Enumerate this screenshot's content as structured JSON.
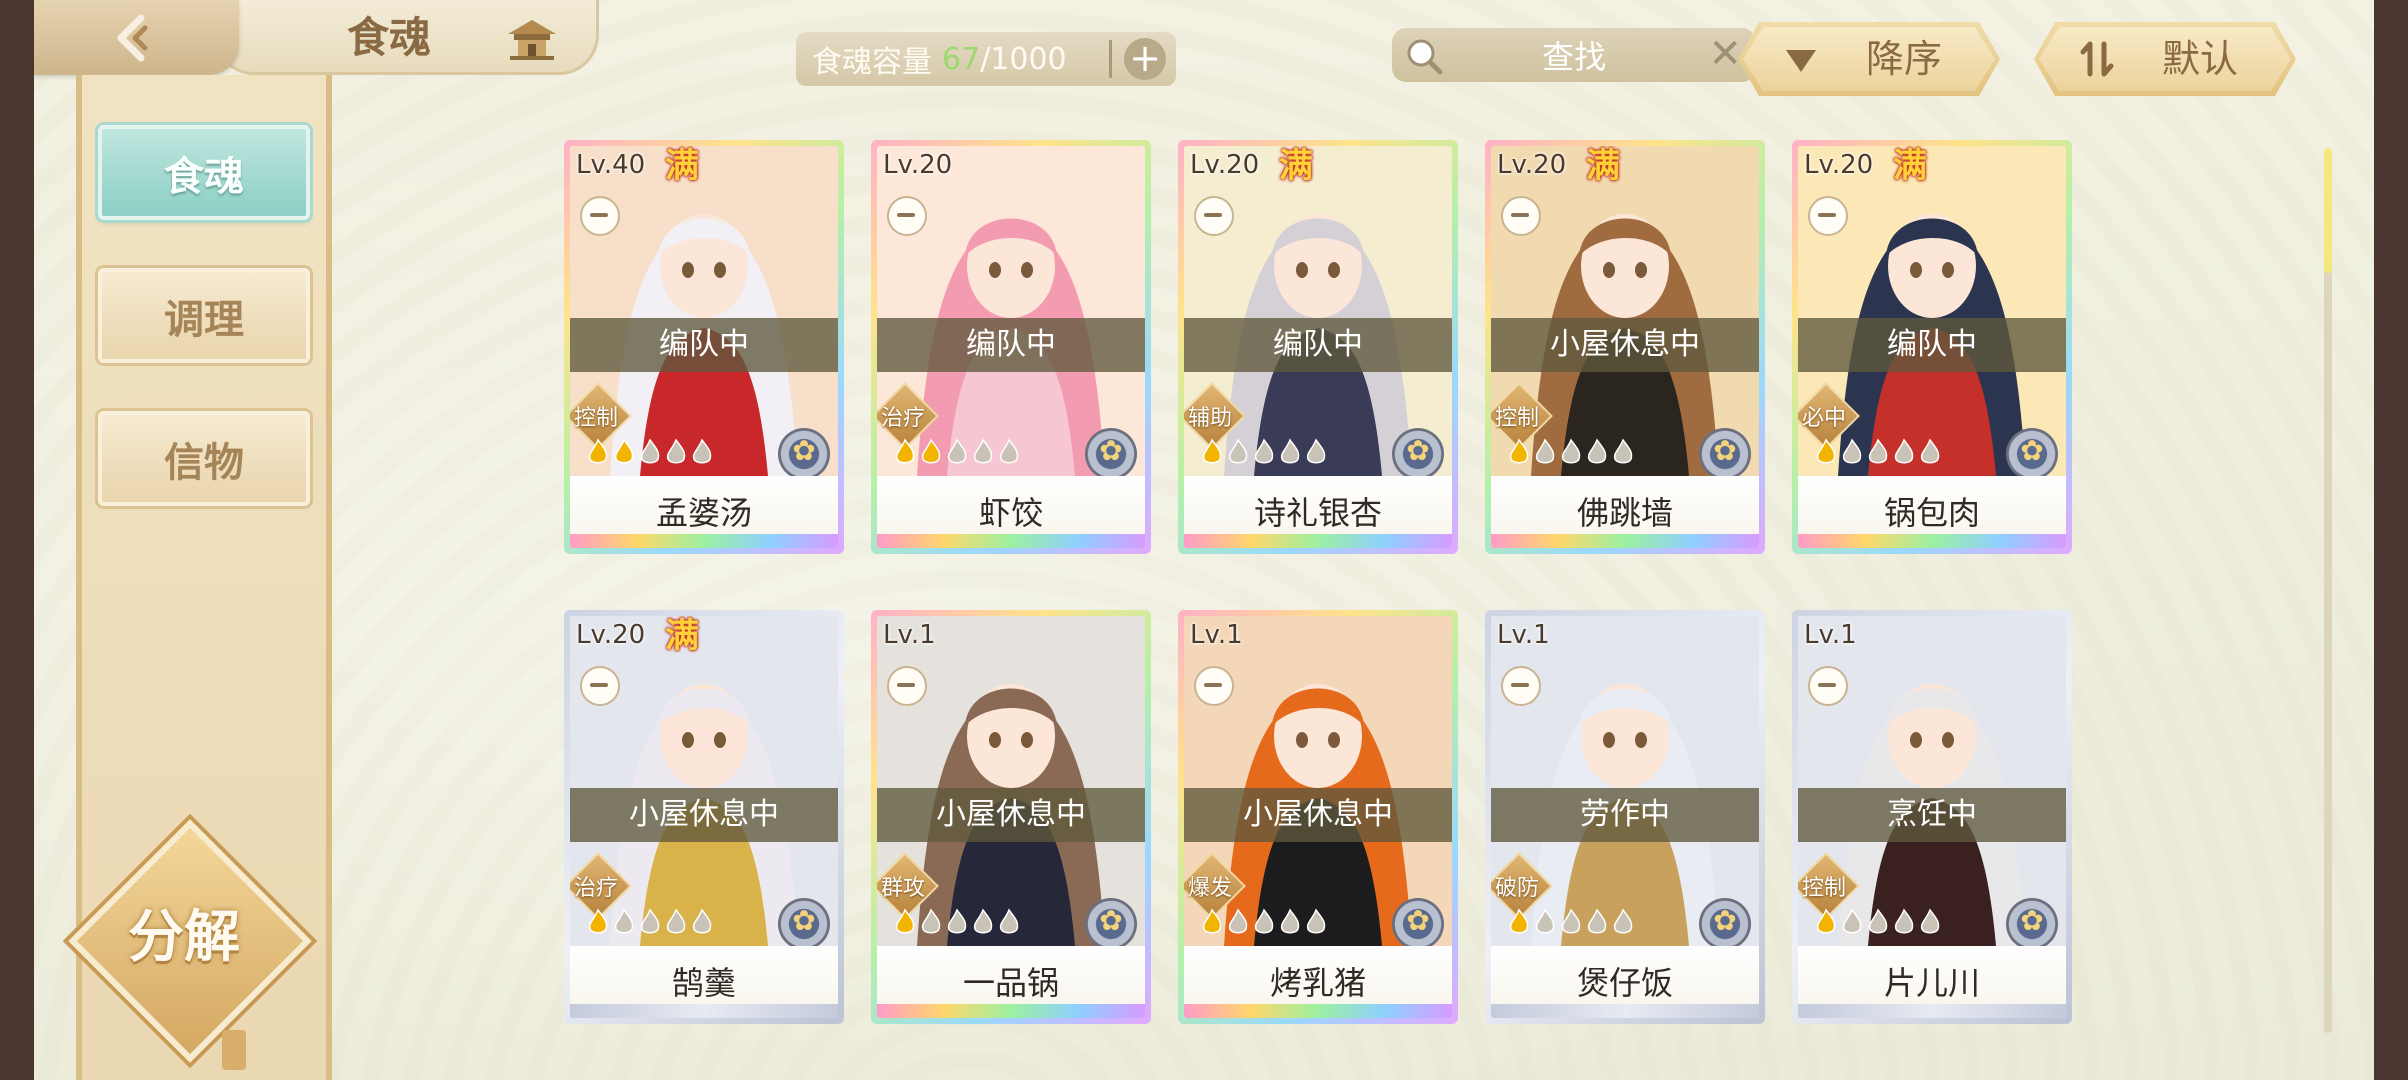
{
  "header": {
    "title": "食魂",
    "capacity": {
      "label": "食魂容量",
      "current": "67",
      "separator": "/",
      "max": "1000"
    },
    "search": {
      "placeholder": "查找"
    },
    "sort_label": "降序",
    "default_label": "默认"
  },
  "sidebar": {
    "tabs": [
      {
        "label": "食魂",
        "active": true
      },
      {
        "label": "调理",
        "active": false
      },
      {
        "label": "信物",
        "active": false
      }
    ],
    "decompose_label": "分解"
  },
  "full_badge_text": "满",
  "cards": [
    {
      "level": "Lv.40",
      "full": true,
      "status": "编队中",
      "role": "控制",
      "name": "孟婆汤",
      "stars": 2,
      "frame": "rainbow",
      "hair": "#f2eff5",
      "bg": "#f7dfc9",
      "accent": "#c8282b"
    },
    {
      "level": "Lv.20",
      "full": false,
      "status": "编队中",
      "role": "治疗",
      "name": "虾饺",
      "stars": 2,
      "frame": "rainbow",
      "hair": "#f39bb0",
      "bg": "#fde7d8",
      "accent": "#f6c6d2"
    },
    {
      "level": "Lv.20",
      "full": true,
      "status": "编队中",
      "role": "辅助",
      "name": "诗礼银杏",
      "stars": 1,
      "frame": "rainbow",
      "hair": "#d4d0d6",
      "bg": "#f4edd0",
      "accent": "#3a3b56"
    },
    {
      "level": "Lv.20",
      "full": true,
      "status": "小屋休息中",
      "role": "控制",
      "name": "佛跳墙",
      "stars": 1,
      "frame": "rainbow",
      "hair": "#a06b3f",
      "bg": "#f1d9b0",
      "accent": "#2b2520"
    },
    {
      "level": "Lv.20",
      "full": true,
      "status": "编队中",
      "role": "必中",
      "name": "锅包肉",
      "stars": 1,
      "frame": "rainbow",
      "hair": "#2c3550",
      "bg": "#fbe8b6",
      "accent": "#c5312a"
    },
    {
      "level": "Lv.20",
      "full": true,
      "status": "小屋休息中",
      "role": "治疗",
      "name": "鹄羹",
      "stars": 1,
      "frame": "silver",
      "hair": "#eceaf0",
      "bg": "#e4e6ee",
      "accent": "#d9b24a"
    },
    {
      "level": "Lv.1",
      "full": false,
      "status": "小屋休息中",
      "role": "群攻",
      "name": "一品锅",
      "stars": 1,
      "frame": "rainbow",
      "hair": "#8a6a55",
      "bg": "#e5e1dc",
      "accent": "#26283a"
    },
    {
      "level": "Lv.1",
      "full": false,
      "status": "小屋休息中",
      "role": "爆发",
      "name": "烤乳猪",
      "stars": 1,
      "frame": "rainbow",
      "hair": "#e66a1c",
      "bg": "#f4d7b8",
      "accent": "#1c1b1e"
    },
    {
      "level": "Lv.1",
      "full": false,
      "status": "劳作中",
      "role": "破防",
      "name": "煲仔饭",
      "stars": 1,
      "frame": "silver",
      "hair": "#e9ecf2",
      "bg": "#e4e6ee",
      "accent": "#c8a25c"
    },
    {
      "level": "Lv.1",
      "full": false,
      "status": "烹饪中",
      "role": "控制",
      "name": "片儿川",
      "stars": 1,
      "frame": "silver",
      "hair": "#e8e8ea",
      "bg": "#e4e6ee",
      "accent": "#3b2020"
    }
  ],
  "total_flames": 5,
  "colors": {
    "flame_lit": "#f2b400",
    "flame_unlit": "#c8c3b6",
    "sidebar_active": "#8ccfc4"
  }
}
